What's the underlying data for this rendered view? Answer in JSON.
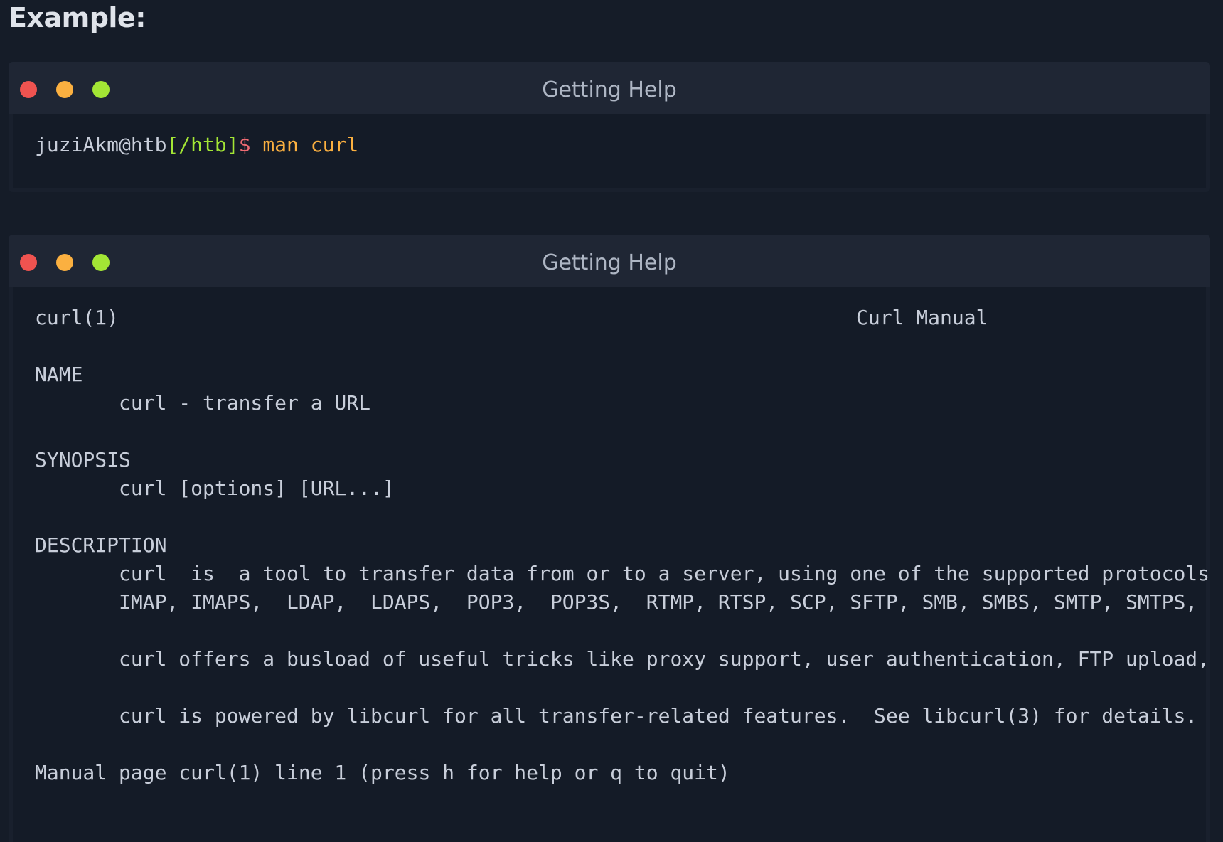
{
  "heading": "Example:",
  "colors": {
    "background": "#151c28",
    "terminal_bg": "#141b27",
    "titlebar_bg": "#1f2634",
    "dot_red": "#ef5350",
    "dot_yellow": "#fbb040",
    "dot_green": "#a3e635",
    "prompt_path": "#a3e635",
    "prompt_sign": "#ef6b73",
    "command": "#fbb040",
    "text": "#c8ceda"
  },
  "terminal1": {
    "title": "Getting Help",
    "prompt": {
      "user": "juziAkm@htb",
      "path": "[/htb]",
      "sign": "$",
      "command": "man curl"
    }
  },
  "terminal2": {
    "title": "Getting Help",
    "header_left": "curl(1)",
    "header_center": "Curl Manual",
    "name_heading": "NAME",
    "name_text": "curl - transfer a URL",
    "synopsis_heading": "SYNOPSIS",
    "synopsis_text": "curl [options] [URL...]",
    "description_heading": "DESCRIPTION",
    "description_line1": "curl  is  a tool to transfer data from or to a server, using one of the supported protocols",
    "description_line2": "IMAP, IMAPS,  LDAP,  LDAPS,  POP3,  POP3S,  RTMP, RTSP, SCP, SFTP, SMB, SMBS, SMTP, SMTPS,",
    "description_line3": "curl offers a busload of useful tricks like proxy support, user authentication, FTP upload,",
    "description_line4": "curl is powered by libcurl for all transfer-related features.  See libcurl(3) for details.",
    "status_line": "Manual page curl(1) line 1 (press h for help or q to quit)"
  }
}
